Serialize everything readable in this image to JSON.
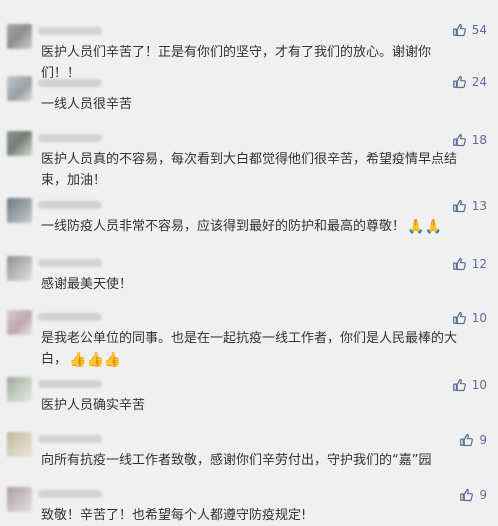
{
  "comments": [
    {
      "text": "医护人员们辛苦了！正是有你们的坚守，才有了我们的放心。谢谢你们！！",
      "likes": "54",
      "emoji": ""
    },
    {
      "text": "一线人员很辛苦",
      "likes": "24",
      "emoji": ""
    },
    {
      "text": "医护人员真的不容易，每次看到大白都觉得他们很辛苦，希望疫情早点结束，加油！",
      "likes": "18",
      "emoji": ""
    },
    {
      "text": "一线防疫人员非常不容易，应该得到最好的防护和最高的尊敬！",
      "likes": "13",
      "emoji": "🙏🙏"
    },
    {
      "text": "感谢最美天使！",
      "likes": "12",
      "emoji": ""
    },
    {
      "text": "是我老公单位的同事。也是在一起抗疫一线工作者，你们是人民最棒的大白，",
      "likes": "10",
      "emoji": "👍👍👍"
    },
    {
      "text": "医护人员确实辛苦",
      "likes": "10",
      "emoji": ""
    },
    {
      "text": "向所有抗疫一线工作者致敬，感谢你们辛劳付出，守护我们的“嘉”园",
      "likes": "9",
      "emoji": ""
    },
    {
      "text": "致敬！辛苦了！也希望每个人都遵守防疫规定!",
      "likes": "9",
      "emoji": ""
    }
  ],
  "icons": {
    "like": "thumbs-up-icon"
  },
  "colors": {
    "background": "#f0f0f0",
    "text": "#333333",
    "like": "#5b6f95"
  }
}
